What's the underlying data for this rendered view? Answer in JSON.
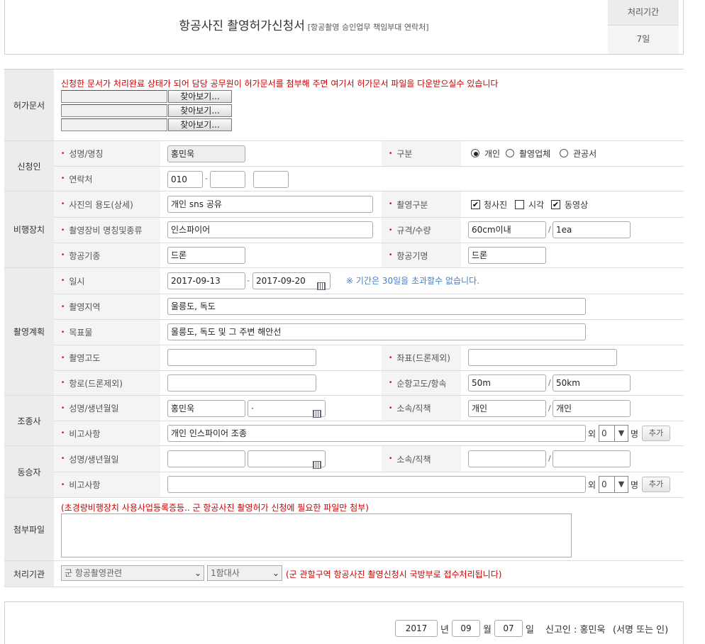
{
  "header": {
    "title": "항공사진 촬영허가신청서",
    "subtitle": "[항공촬영 승인업무 책임부대 연락처]",
    "period_label": "처리기간",
    "period_value": "7일"
  },
  "permit": {
    "section": "허가문서",
    "notice": "신청한 문서가 처리완료 상태가 되어 담당 공무원이 허가문서를 첨부해 주면 여기서 허가문서 파일을 다운받으실수 있습니다",
    "browse_label": "찾아보기..."
  },
  "applicant": {
    "section": "신청인",
    "name_label": "성명/명칭",
    "name_value": "홍민욱",
    "type_label": "구분",
    "type_options": [
      "개인",
      "촬영업체",
      "관공서"
    ],
    "type_selected": "개인",
    "contact_label": "연락처",
    "phone1": "010",
    "phone_sep": "-"
  },
  "aircraft": {
    "section": "비행장치",
    "purpose_label": "사진의 용도(상세)",
    "purpose_value": "개인 sns 공유",
    "shoot_type_label": "촬영구분",
    "shoot_options": [
      "청사진",
      "시각",
      "동영상"
    ],
    "shoot_checked": [
      true,
      false,
      true
    ],
    "equip_label": "촬영장비 명칭및종류",
    "equip_value": "인스파이어",
    "spec_label": "규격/수량",
    "spec_value": "60cm이내",
    "qty_value": "1ea",
    "model_label": "항공기종",
    "model_value": "드론",
    "name_label": "항공기명",
    "name_value": "드론"
  },
  "plan": {
    "section": "촬영계획",
    "date_label": "일시",
    "date_from": "2017-09-13",
    "date_to": "2017-09-20",
    "date_note": "※ 기간은 30일을 초과할수 없습니다.",
    "area_label": "촬영지역",
    "area_value": "울릉도, 독도",
    "target_label": "목표물",
    "target_value": "울릉도, 독도 및 그 주변 해안선",
    "altitude_label": "촬영고도",
    "coord_label": "좌표(드론제외)",
    "route_label": "항로(드론제외)",
    "cruise_label": "순항고도/항속",
    "cruise_alt": "50m",
    "cruise_speed": "50km"
  },
  "pilot": {
    "section": "조종사",
    "name_label": "성명/생년월일",
    "name_value": "홍민욱",
    "birth_value": "·",
    "org_label": "소속/직책",
    "org_value": "개인",
    "position_value": "개인",
    "remark_label": "비고사항",
    "remark_value": "개인 인스파이어 조종",
    "extra_prefix": "외",
    "extra_count": "0",
    "extra_suffix": "명",
    "add_label": "추가"
  },
  "passenger": {
    "section": "동승자",
    "name_label": "성명/생년월일",
    "org_label": "소속/직책",
    "remark_label": "비고사항",
    "extra_prefix": "외",
    "extra_count": "0",
    "extra_suffix": "명",
    "add_label": "추가"
  },
  "attachment": {
    "section": "첨부파일",
    "notice": "(초경량비행장치 사용사업등록증등.. 군 항공사진 촬영허가 신청에 필요한 파일만 첨부)"
  },
  "agency": {
    "section": "처리기관",
    "select1": "군 항공촬영관련",
    "select2": "1함대사",
    "notice": "(군 관할구역 항공사진 촬영신청시 국방부로 접수처리됩니다)"
  },
  "footer": {
    "year": "2017",
    "year_unit": "년",
    "month": "09",
    "month_unit": "월",
    "day": "07",
    "day_unit": "일",
    "reporter": "신고인 : 홍민욱",
    "sign": "(서명 또는 인)"
  }
}
